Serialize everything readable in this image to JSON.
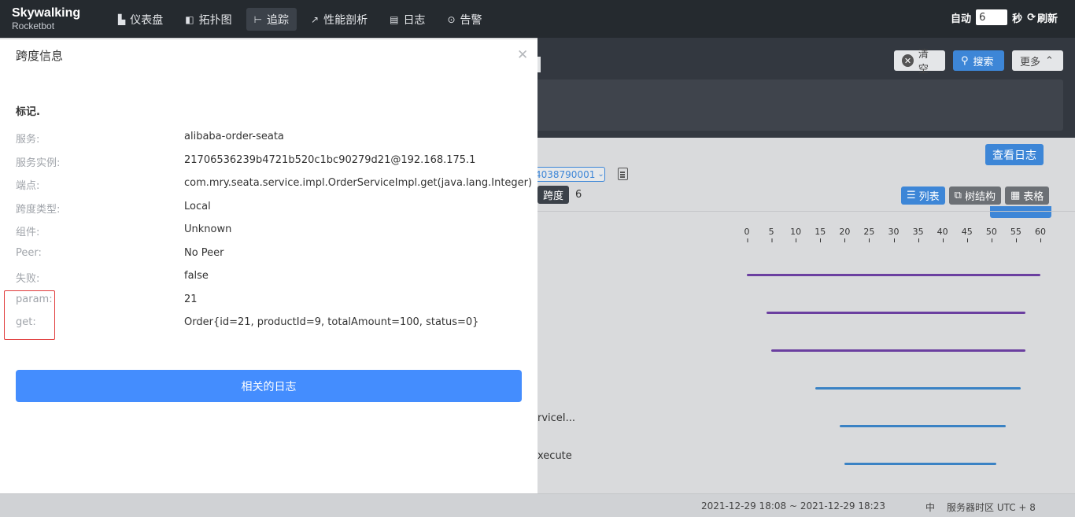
{
  "brand": {
    "name": "Skywalking",
    "sub": "Rocketbot"
  },
  "nav": [
    {
      "label": "仪表盘",
      "icon": "dashboard-icon",
      "glyph": "▙"
    },
    {
      "label": "拓扑图",
      "icon": "topology-icon",
      "glyph": "◧"
    },
    {
      "label": "追踪",
      "icon": "trace-icon",
      "glyph": "⊢"
    },
    {
      "label": "性能剖析",
      "icon": "profile-icon",
      "glyph": "↗"
    },
    {
      "label": "日志",
      "icon": "log-icon",
      "glyph": "▤"
    },
    {
      "label": "告警",
      "icon": "alarm-icon",
      "glyph": "⊙"
    }
  ],
  "auto_refresh": {
    "label": "自动",
    "value": "6",
    "unit": "秒",
    "refresh_label": "刷新"
  },
  "search_bar": {
    "clear_label": "清空",
    "search_label": "搜索",
    "more_label": "更多"
  },
  "trace_panel": {
    "view_logs_label": "查看日志",
    "trace_id_fragment": "4038790001",
    "span_label": "跨度",
    "span_count": "6",
    "list_label": "列表",
    "tree_label": "树结构",
    "table_label": "表格",
    "axis_ticks": [
      "0",
      "5",
      "10",
      "15",
      "20",
      "25",
      "30",
      "35",
      "40",
      "45",
      "50",
      "55",
      "60"
    ],
    "row_fragments": [
      "rviceI...",
      "xecute"
    ]
  },
  "span_bars_ms": [
    {
      "start": 0,
      "end": 60,
      "color": "#6b3fa0"
    },
    {
      "start": 4,
      "end": 57,
      "color": "#6b3fa0"
    },
    {
      "start": 5,
      "end": 57,
      "color": "#6b3fa0"
    },
    {
      "start": 14,
      "end": 56,
      "color": "#3a82c4"
    },
    {
      "start": 19,
      "end": 53,
      "color": "#3a82c4"
    },
    {
      "start": 20,
      "end": 51,
      "color": "#3a82c4"
    }
  ],
  "drawer": {
    "title": "跨度信息",
    "section": "标记.",
    "fields": [
      {
        "key": "服务:",
        "value": "alibaba-order-seata"
      },
      {
        "key": "服务实例:",
        "value": "21706536239b4721b520c1bc90279d21@192.168.175.1"
      },
      {
        "key": "端点:",
        "value": "com.mry.seata.service.impl.OrderServiceImpl.get(java.lang.Integer)"
      },
      {
        "key": "跨度类型:",
        "value": "Local"
      },
      {
        "key": "组件:",
        "value": "Unknown"
      },
      {
        "key": "Peer:",
        "value": "No Peer"
      },
      {
        "key": "失败:",
        "value": "false"
      },
      {
        "key": "param:",
        "value": "21"
      },
      {
        "key": "get:",
        "value": "Order{id=21, productId=9, totalAmount=100, status=0}"
      }
    ],
    "related_logs_label": "相关的日志"
  },
  "footer": {
    "time_range": "2021-12-29 18:08 ~ 2021-12-29 18:23",
    "lang": "中",
    "timezone": "服务器时区 UTC + 8"
  }
}
